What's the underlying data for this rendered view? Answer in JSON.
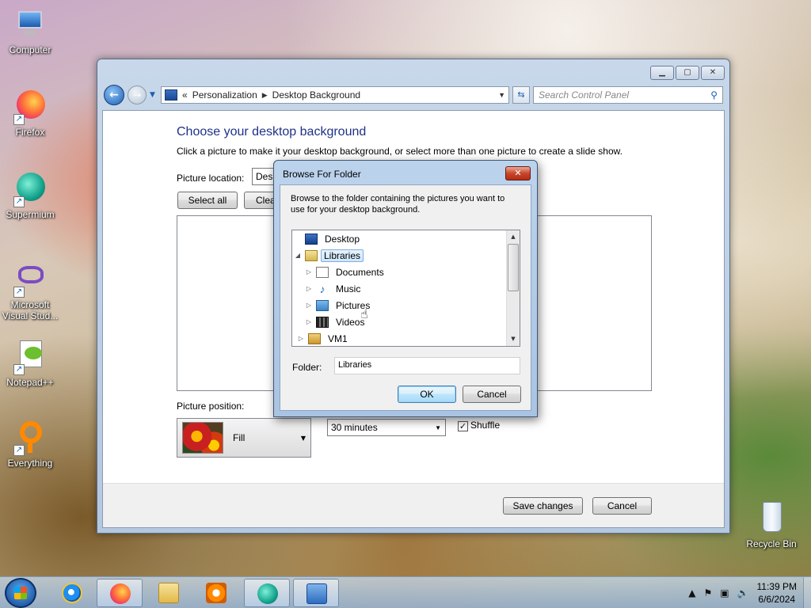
{
  "desktop": {
    "icons": [
      {
        "label": "Computer"
      },
      {
        "label": "Firefox"
      },
      {
        "label": "Supermium"
      },
      {
        "label": "Microsoft Visual Stud..."
      },
      {
        "label": "Notepad++"
      },
      {
        "label": "Everything"
      },
      {
        "label": "Recycle Bin"
      }
    ]
  },
  "control_panel": {
    "address": {
      "prefix": "«",
      "crumbs": [
        "Personalization",
        "Desktop Background"
      ]
    },
    "search_placeholder": "Search Control Panel",
    "heading": "Choose your desktop background",
    "subtext": "Click a picture to make it your desktop background, or select more than one picture to create a slide show.",
    "picture_location_label": "Picture location:",
    "picture_location_value": "Desk",
    "select_all_label": "Select all",
    "clear_label": "Clea",
    "picture_position_label": "Picture position:",
    "picture_position_value": "Fill",
    "interval_value": "30 minutes",
    "shuffle_label": "Shuffle",
    "shuffle_checked": true,
    "save_label": "Save changes",
    "cancel_label": "Cancel"
  },
  "browse_dialog": {
    "title": "Browse For Folder",
    "description": "Browse to the folder containing the pictures you want to use for your desktop background.",
    "tree": [
      {
        "label": "Desktop",
        "icon": "desktop-icon",
        "level": 0,
        "expander": ""
      },
      {
        "label": "Libraries",
        "icon": "libraries-icon",
        "level": 0,
        "expander": "◢",
        "selected": true
      },
      {
        "label": "Documents",
        "icon": "documents-icon",
        "level": 1,
        "expander": "▷"
      },
      {
        "label": "Music",
        "icon": "music-icon",
        "level": 1,
        "expander": "▷"
      },
      {
        "label": "Pictures",
        "icon": "pictures-icon",
        "level": 1,
        "expander": "▷"
      },
      {
        "label": "Videos",
        "icon": "videos-icon",
        "level": 1,
        "expander": "▷"
      },
      {
        "label": "VM1",
        "icon": "vm-folder-icon",
        "level": 0,
        "expander": "▷"
      }
    ],
    "folder_label": "Folder:",
    "folder_value": "Libraries",
    "ok_label": "OK",
    "cancel_label": "Cancel"
  },
  "taskbar": {
    "clock_time": "11:39 PM",
    "clock_date": "6/6/2024",
    "items": [
      "internet-explorer",
      "firefox",
      "file-explorer",
      "media-player",
      "supermium",
      "control-panel"
    ]
  }
}
